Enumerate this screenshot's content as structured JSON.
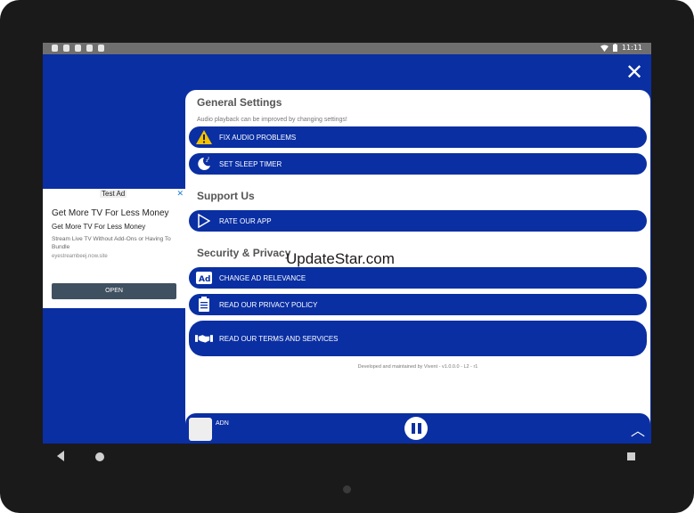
{
  "status": {
    "time": "11:11"
  },
  "close_label": "✕",
  "ad": {
    "tag": "Test Ad",
    "close": "✕",
    "title": "Get More TV For Less Money",
    "subtitle": "Get More TV For Less Money",
    "description": "Stream Live TV Without Add-Ons or Having To Bundle",
    "url": "eyestreambeej.now.site",
    "open_label": "OPEN"
  },
  "sections": {
    "general": {
      "title": "General Settings",
      "hint": "Audio playback can be improved by changing settings!"
    },
    "support": {
      "title": "Support Us"
    },
    "security": {
      "title": "Security & Privacy"
    }
  },
  "buttons": {
    "fix_audio": "FIX AUDIO PROBLEMS",
    "sleep_timer": "SET SLEEP TIMER",
    "rate_app": "RATE OUR APP",
    "ad_relevance": "CHANGE AD RELEVANCE",
    "privacy_policy": "READ OUR PRIVACY POLICY",
    "terms": "READ OUR TERMS AND SERVICES"
  },
  "ad_icon_text": "Ad",
  "footer_note": "Developed and maintained by Vivent - v1.0.0.0 - L2 - r1",
  "watermark": "UpdateStar.com",
  "player": {
    "name": "ADN",
    "up": "︿"
  },
  "colors": {
    "primary": "#0a2fa3",
    "warning": "#f2c200"
  }
}
